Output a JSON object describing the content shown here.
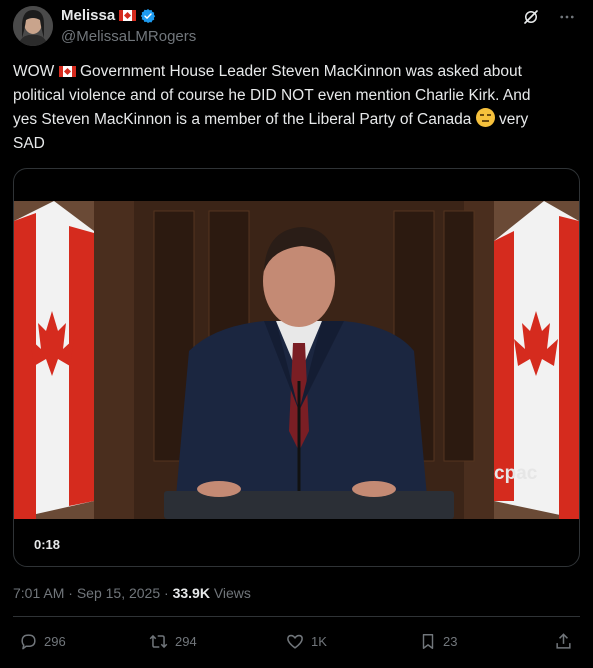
{
  "author": {
    "name": "Melissa",
    "handle": "@MelissaLMRogers"
  },
  "tweet": {
    "line_1_a": "WOW",
    "line_1_b": "Government House Leader Steven MacKinnon was asked about",
    "line_2": "political violence and of course he DID NOT even mention Charlie Kirk. And",
    "line_3_a": "yes Steven MacKinnon is a member of the Liberal Party of Canada",
    "line_3_b": "very",
    "line_4": "SAD"
  },
  "media": {
    "duration": "0:18",
    "watermark": "cpac"
  },
  "meta": {
    "time": "7:01 AM",
    "date": "Sep 15, 2025",
    "views_count": "33.9K",
    "views_label": "Views"
  },
  "actions": {
    "replies": "296",
    "reposts": "294",
    "likes": "1K",
    "bookmarks": "23"
  },
  "colors": {
    "background": "#000000",
    "text": "#e7e9ea",
    "muted": "#71767b",
    "verified": "#1d9bf0"
  }
}
